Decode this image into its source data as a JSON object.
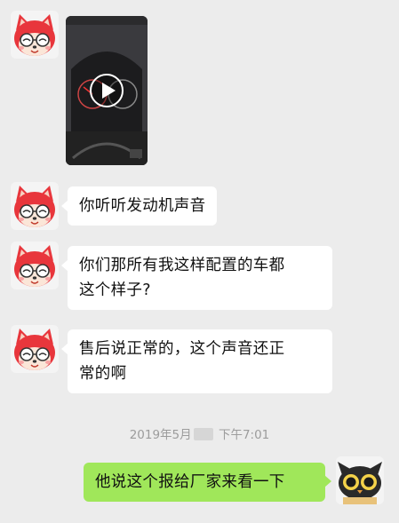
{
  "chat": {
    "messages": [
      {
        "type": "video",
        "sender": "other"
      },
      {
        "type": "text",
        "sender": "other",
        "line1": "你听听发动机声音"
      },
      {
        "type": "text",
        "sender": "other",
        "line1": "你们那所有我这样配置的车都",
        "line2": "这个样子?"
      },
      {
        "type": "text",
        "sender": "other",
        "line1": "售后说正常的，这个声音还正",
        "line2": "常的啊"
      },
      {
        "type": "text",
        "sender": "self",
        "line1": "他说这个报给厂家来看一下"
      }
    ],
    "timestamp": {
      "date_part": "2019年5月",
      "time_part": "下午7:01"
    }
  },
  "icons": {
    "other_avatar": "red-fox-avatar-icon",
    "self_avatar": "black-cat-avatar-icon",
    "video_play": "play-icon"
  },
  "colors": {
    "background": "#ececec",
    "bubble_other": "#ffffff",
    "bubble_self": "#a0e75a",
    "timestamp_text": "#9c9c9c"
  }
}
